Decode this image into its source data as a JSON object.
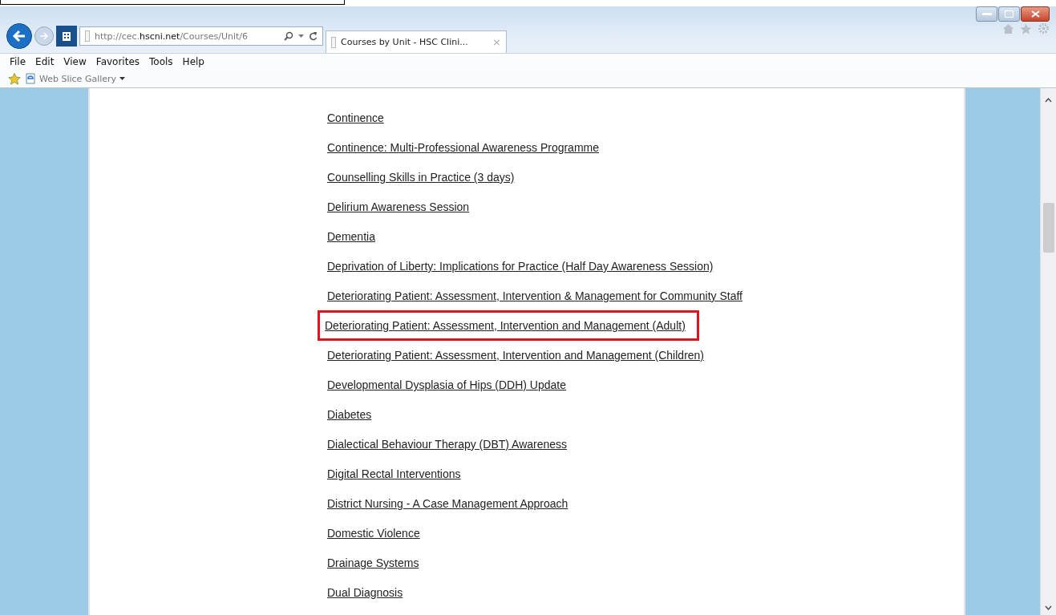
{
  "address_bar": {
    "url": "http://cec.**hscni.net**/Courses/Unit/6"
  },
  "tabs": [
    {
      "label": "Courses by Unit - HSC Clini...",
      "close": "×",
      "selected": true
    }
  ],
  "menu_bar": [
    "File",
    "Edit",
    "View",
    "Favorites",
    "Tools",
    "Help"
  ],
  "favorites_bar": [
    {
      "label": "Web Slice Gallery"
    }
  ],
  "courses": [
    {
      "label": "Continence",
      "highlighted": false
    },
    {
      "label": "Continence: Multi-Professional Awareness Programme",
      "highlighted": false
    },
    {
      "label": "Counselling Skills in Practice (3 days)",
      "highlighted": false
    },
    {
      "label": "Delirium Awareness Session",
      "highlighted": false
    },
    {
      "label": "Dementia",
      "highlighted": false
    },
    {
      "label": "Deprivation of Liberty: Implications for Practice (Half Day Awareness Session)",
      "highlighted": false
    },
    {
      "label": "Deteriorating Patient: Assessment, Intervention & Management for Community Staff",
      "highlighted": false
    },
    {
      "label": "Deteriorating Patient: Assessment, Intervention and Management (Adult)",
      "highlighted": true
    },
    {
      "label": "Deteriorating Patient: Assessment, Intervention and Management (Children)",
      "highlighted": false
    },
    {
      "label": "Developmental Dysplasia of Hips (DDH) Update",
      "highlighted": false
    },
    {
      "label": "Diabetes",
      "highlighted": false
    },
    {
      "label": "Dialectical Behaviour Therapy (DBT) Awareness",
      "highlighted": false
    },
    {
      "label": "Digital Rectal Interventions",
      "highlighted": false
    },
    {
      "label": "District Nursing - A Case Management Approach",
      "highlighted": false
    },
    {
      "label": "Domestic Violence",
      "highlighted": false
    },
    {
      "label": "Drainage Systems",
      "highlighted": false
    },
    {
      "label": "Dual Diagnosis",
      "highlighted": false
    }
  ]
}
